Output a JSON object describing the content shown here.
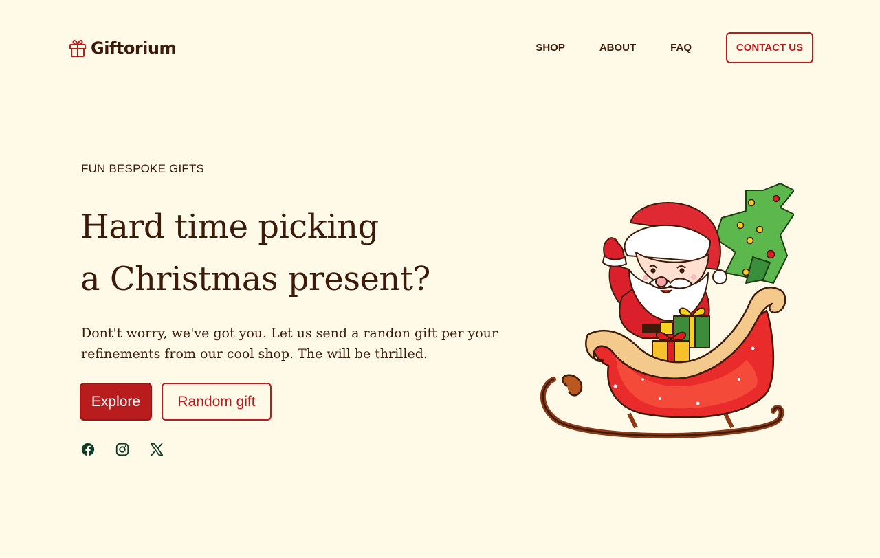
{
  "brand": {
    "name": "Giftorium",
    "icon": "gift-icon"
  },
  "nav": {
    "links": [
      {
        "label": "SHOP"
      },
      {
        "label": "ABOUT"
      },
      {
        "label": "FAQ"
      }
    ],
    "contact_label": "CONTACT US"
  },
  "hero": {
    "eyebrow": "FUN BESPOKE GIFTS",
    "headline_line1": "Hard time picking",
    "headline_line2": "a Christmas present?",
    "subcopy": "Dont't worry, we've got you. Let us send a randon gift per your refinements from our cool shop. The will be thrilled.",
    "primary_button": "Explore",
    "secondary_button": "Random gift",
    "illustration": "santa-sleigh-illustration"
  },
  "social": [
    {
      "icon": "facebook-icon"
    },
    {
      "icon": "instagram-icon"
    },
    {
      "icon": "x-icon"
    }
  ],
  "colors": {
    "background": "#fefae7",
    "text": "#3d1a0a",
    "accent": "#b91c1c",
    "social": "#0f3b2a"
  }
}
